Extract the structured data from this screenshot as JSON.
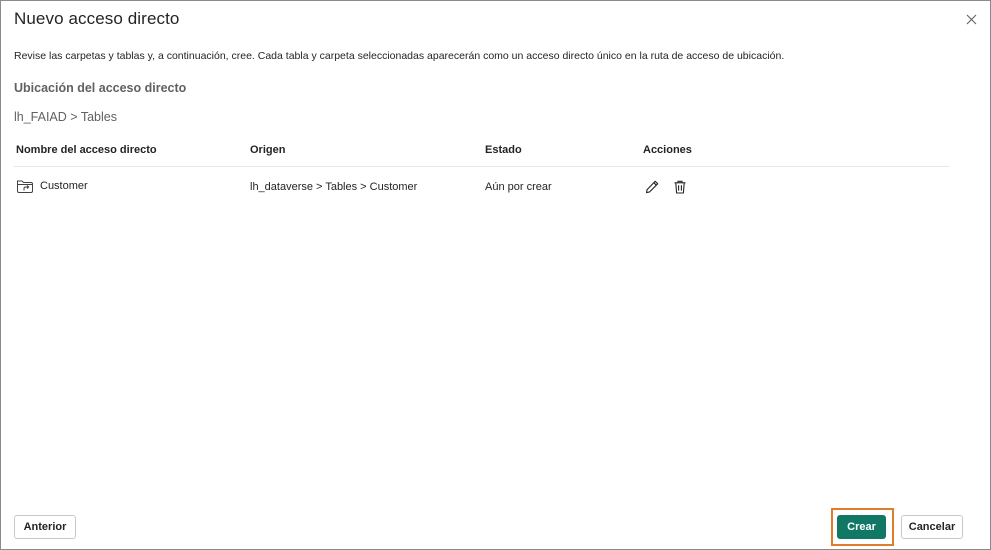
{
  "dialog": {
    "title": "Nuevo acceso directo",
    "description": "Revise las carpetas y tablas y, a continuación, cree. Cada tabla y carpeta seleccionadas aparecerán como un acceso directo único en la ruta de acceso de ubicación.",
    "location_label": "Ubicación del acceso directo",
    "location_path": "lh_FAIAD > Tables"
  },
  "table": {
    "headers": [
      "Nombre del acceso directo",
      "Origen",
      "Estado",
      "Acciones"
    ],
    "rows": [
      {
        "name": "Customer",
        "origin": "lh_dataverse > Tables > Customer",
        "status": "Aún por crear"
      }
    ]
  },
  "footer": {
    "back_label": "Anterior",
    "create_label": "Crear",
    "cancel_label": "Cancelar"
  },
  "colors": {
    "primary": "#117865",
    "highlight": "#e07d2b"
  },
  "icons": [
    "close-icon",
    "shortcut-folder-icon",
    "edit-icon",
    "delete-icon"
  ]
}
